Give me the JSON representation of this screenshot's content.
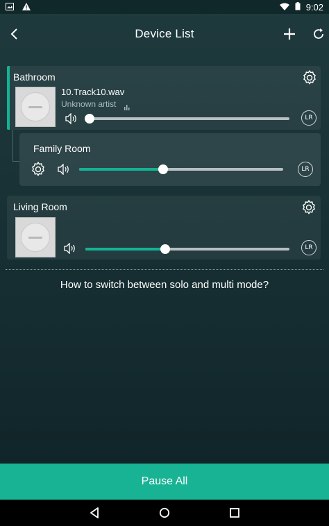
{
  "status_bar": {
    "time": "9:02",
    "icons": [
      "image-icon",
      "warning-icon",
      "wifi-icon",
      "battery-icon"
    ]
  },
  "header": {
    "title": "Device List",
    "icons": [
      "back-icon",
      "add-icon",
      "refresh-icon"
    ]
  },
  "devices": [
    {
      "name": "Bathroom",
      "track": "10.Track10.wav",
      "artist": "Unknown artist",
      "volume": 0.0,
      "channel": "LR",
      "active": true
    },
    {
      "name": "Family Room",
      "volume": 0.41,
      "channel": "LR",
      "grouped_with": "Bathroom"
    },
    {
      "name": "Living Room",
      "volume": 0.39,
      "channel": "LR"
    }
  ],
  "help_text": "How to switch between solo and multi mode?",
  "pause_all_label": "Pause All",
  "colors": {
    "accent": "#13b394",
    "background": "#1a3337"
  }
}
